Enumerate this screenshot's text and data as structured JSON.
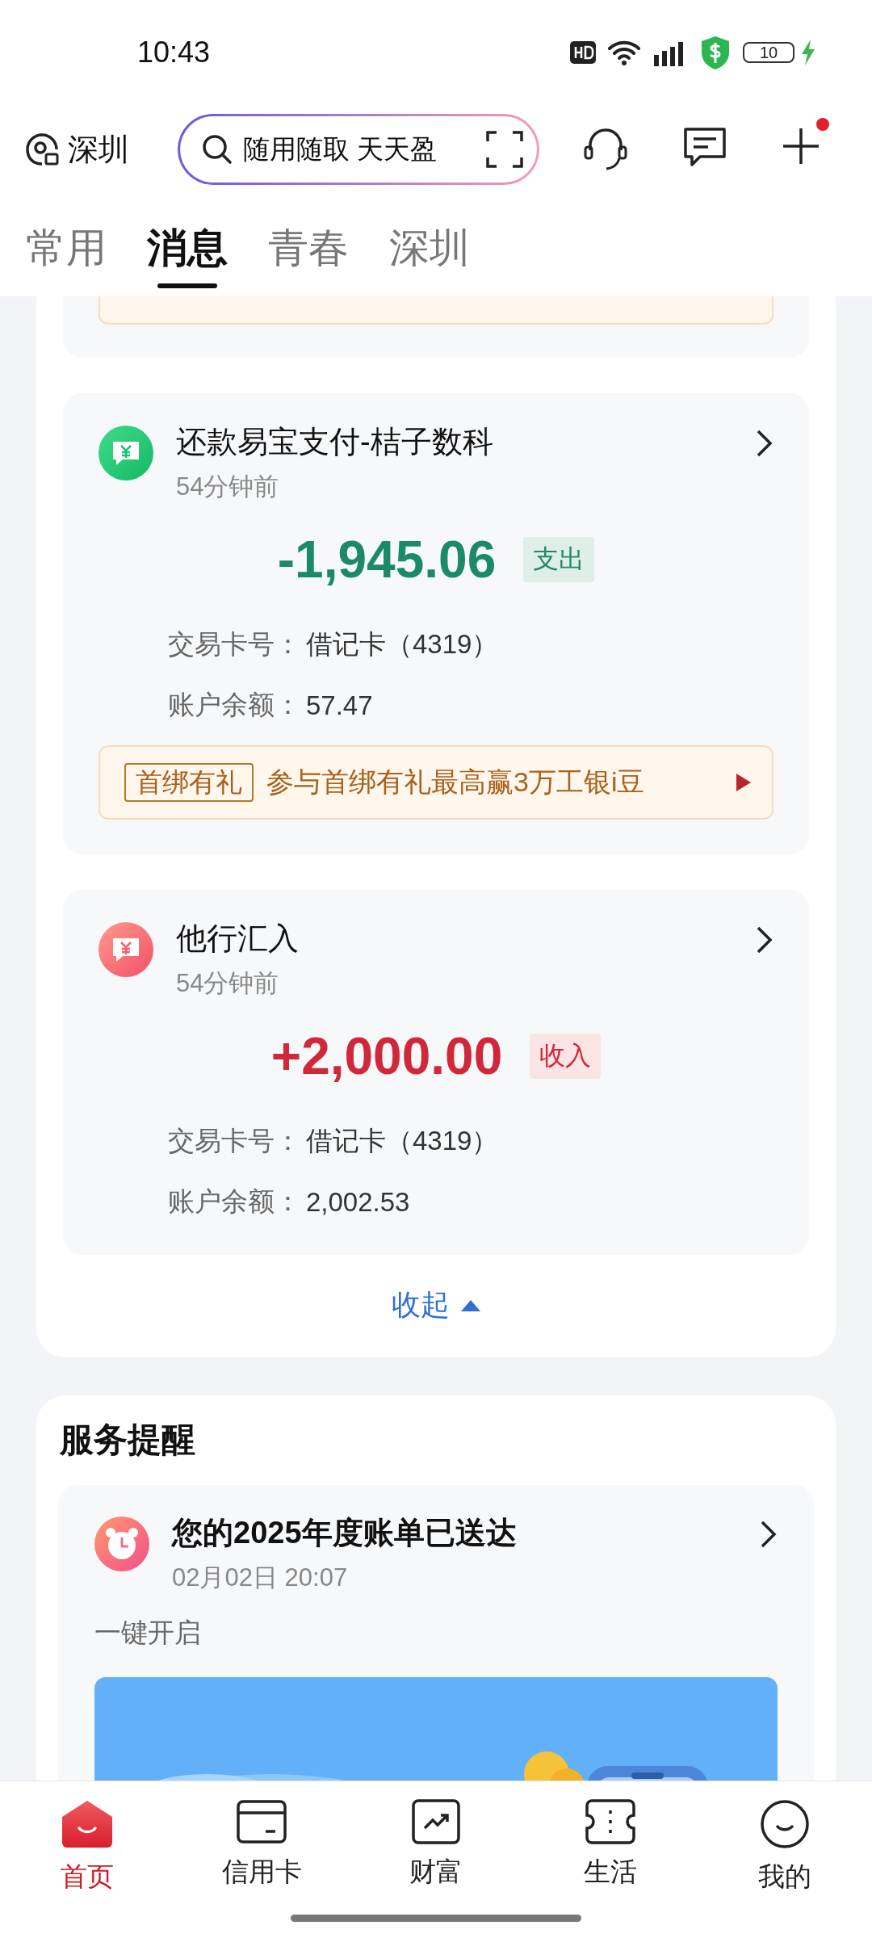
{
  "status_bar": {
    "time": "10:43",
    "battery": "10"
  },
  "header": {
    "location": "深圳",
    "search": {
      "placeholder": "随用随取 天天盈"
    },
    "notification_dot": true
  },
  "tabs": [
    {
      "label": "常用",
      "selected": false
    },
    {
      "label": "消息",
      "selected": true
    },
    {
      "label": "青春",
      "selected": false
    },
    {
      "label": "深圳",
      "selected": false
    }
  ],
  "messages": [
    {
      "kind": "expense",
      "title": "还款易宝支付-桔子数科",
      "time": "54分钟前",
      "amount": "-1,945.06",
      "tag": "支出",
      "fields": [
        {
          "label": "交易卡号：",
          "value": "借记卡（4319）"
        },
        {
          "label": "账户余额：",
          "value": "57.47"
        }
      ],
      "promo": {
        "badge": "首绑有礼",
        "text": "参与首绑有礼最高赢3万工银i豆"
      }
    },
    {
      "kind": "income",
      "title": "他行汇入",
      "time": "54分钟前",
      "amount": "+2,000.00",
      "tag": "收入",
      "fields": [
        {
          "label": "交易卡号：",
          "value": "借记卡（4319）"
        },
        {
          "label": "账户余额：",
          "value": "2,002.53"
        }
      ]
    }
  ],
  "collapse": "收起",
  "service": {
    "title": "服务提醒",
    "items": [
      {
        "title": "您的2025年度账单已送达",
        "time": "02月02日 20:07",
        "text": "一键开启"
      }
    ]
  },
  "bottom_nav": [
    {
      "label": "首页",
      "selected": true
    },
    {
      "label": "信用卡",
      "selected": false
    },
    {
      "label": "财富",
      "selected": false
    },
    {
      "label": "生活",
      "selected": false
    },
    {
      "label": "我的",
      "selected": false
    }
  ]
}
